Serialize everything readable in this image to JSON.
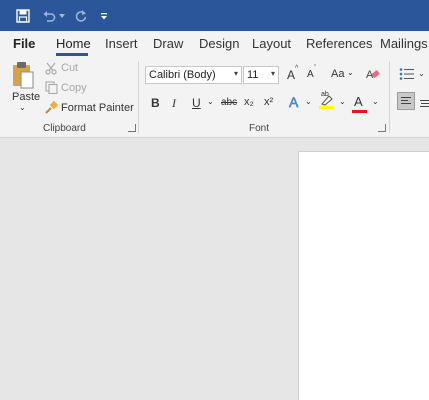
{
  "quick_access": {
    "icons": [
      "save-icon",
      "undo-icon",
      "redo-icon",
      "customize-icon"
    ]
  },
  "tabs": {
    "items": [
      "File",
      "Home",
      "Insert",
      "Draw",
      "Design",
      "Layout",
      "References",
      "Mailings"
    ],
    "active": "Home"
  },
  "clipboard": {
    "paste_label": "Paste",
    "cut_label": "Cut",
    "copy_label": "Copy",
    "format_painter_label": "Format Painter",
    "group_label": "Clipboard"
  },
  "font": {
    "font_name": "Calibri (Body)",
    "font_size": "11",
    "group_label": "Font",
    "case_label": "Aa",
    "bold": "B",
    "italic": "I",
    "underline": "U",
    "strikethrough": "abc",
    "subscript": "x₂",
    "superscript": "x²",
    "highlight_text": "ab",
    "font_color_letter": "A",
    "grow": "A",
    "shrink": "A",
    "effects": "A"
  },
  "colors": {
    "title_bar": "#2b579a",
    "highlight": "#ffff00",
    "font_color": "#e81123"
  }
}
